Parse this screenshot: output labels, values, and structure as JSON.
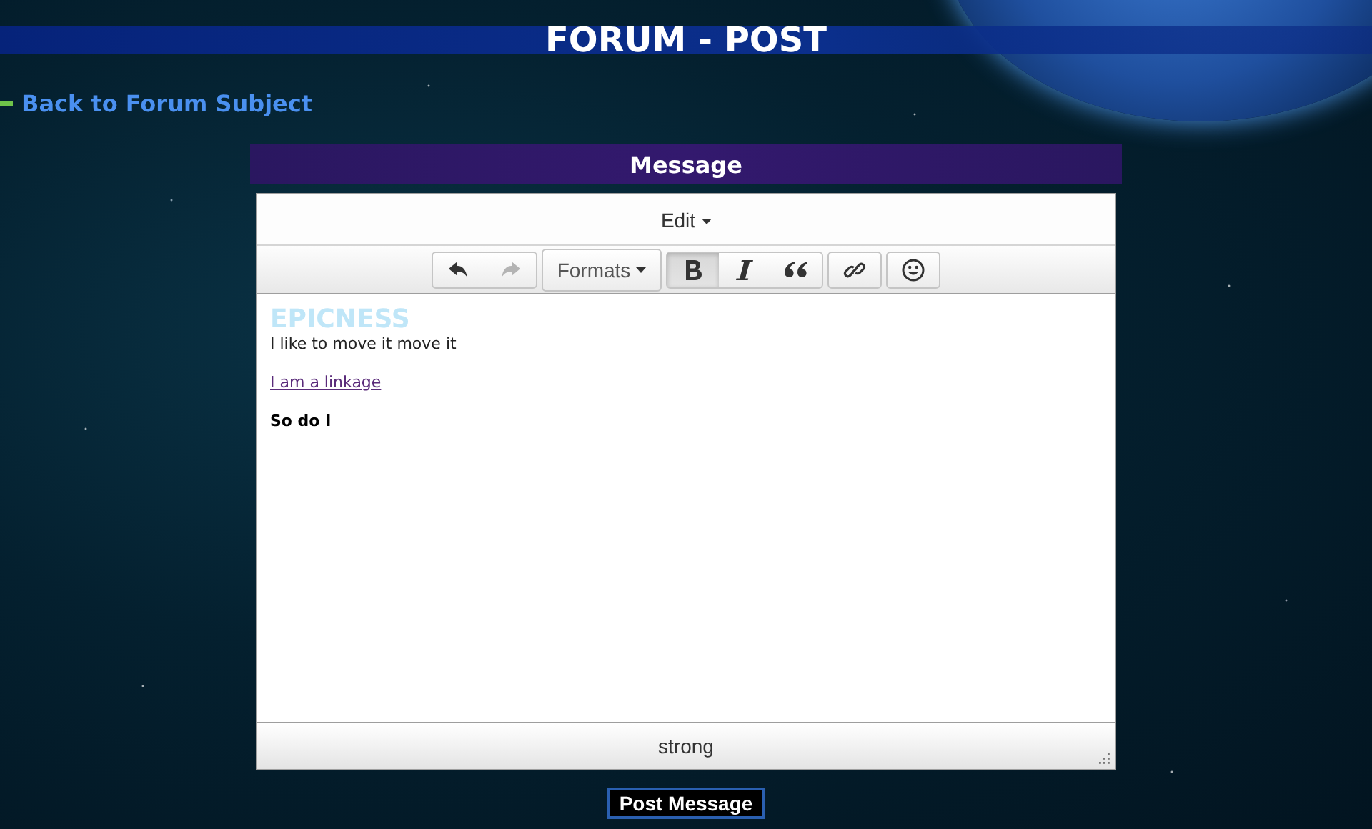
{
  "page_title": "FORUM - POST",
  "back_link": "Back to Forum Subject",
  "section_title": "Message",
  "editor": {
    "menu": [
      {
        "label": "Edit"
      }
    ],
    "toolbar": [
      {
        "items": [
          {
            "kind": "undo",
            "disabled": false
          },
          {
            "kind": "redo",
            "disabled": true
          }
        ]
      },
      {
        "items": [
          {
            "kind": "dropdown",
            "label": "Formats"
          }
        ]
      },
      {
        "items": [
          {
            "kind": "bold",
            "active": true
          },
          {
            "kind": "italic",
            "active": false
          },
          {
            "kind": "quote",
            "active": false
          }
        ]
      },
      {
        "items": [
          {
            "kind": "link",
            "active": false
          }
        ]
      },
      {
        "items": [
          {
            "kind": "emoticon",
            "active": false
          }
        ]
      }
    ],
    "content": [
      {
        "kind": "heading",
        "text": "EPICNESS"
      },
      {
        "kind": "line",
        "text": "I like to move it move it"
      },
      {
        "kind": "link",
        "text": "I am a linkage"
      },
      {
        "kind": "bold",
        "text": "So do I"
      }
    ],
    "status_path": "strong"
  },
  "submit_button": "Post Message"
}
